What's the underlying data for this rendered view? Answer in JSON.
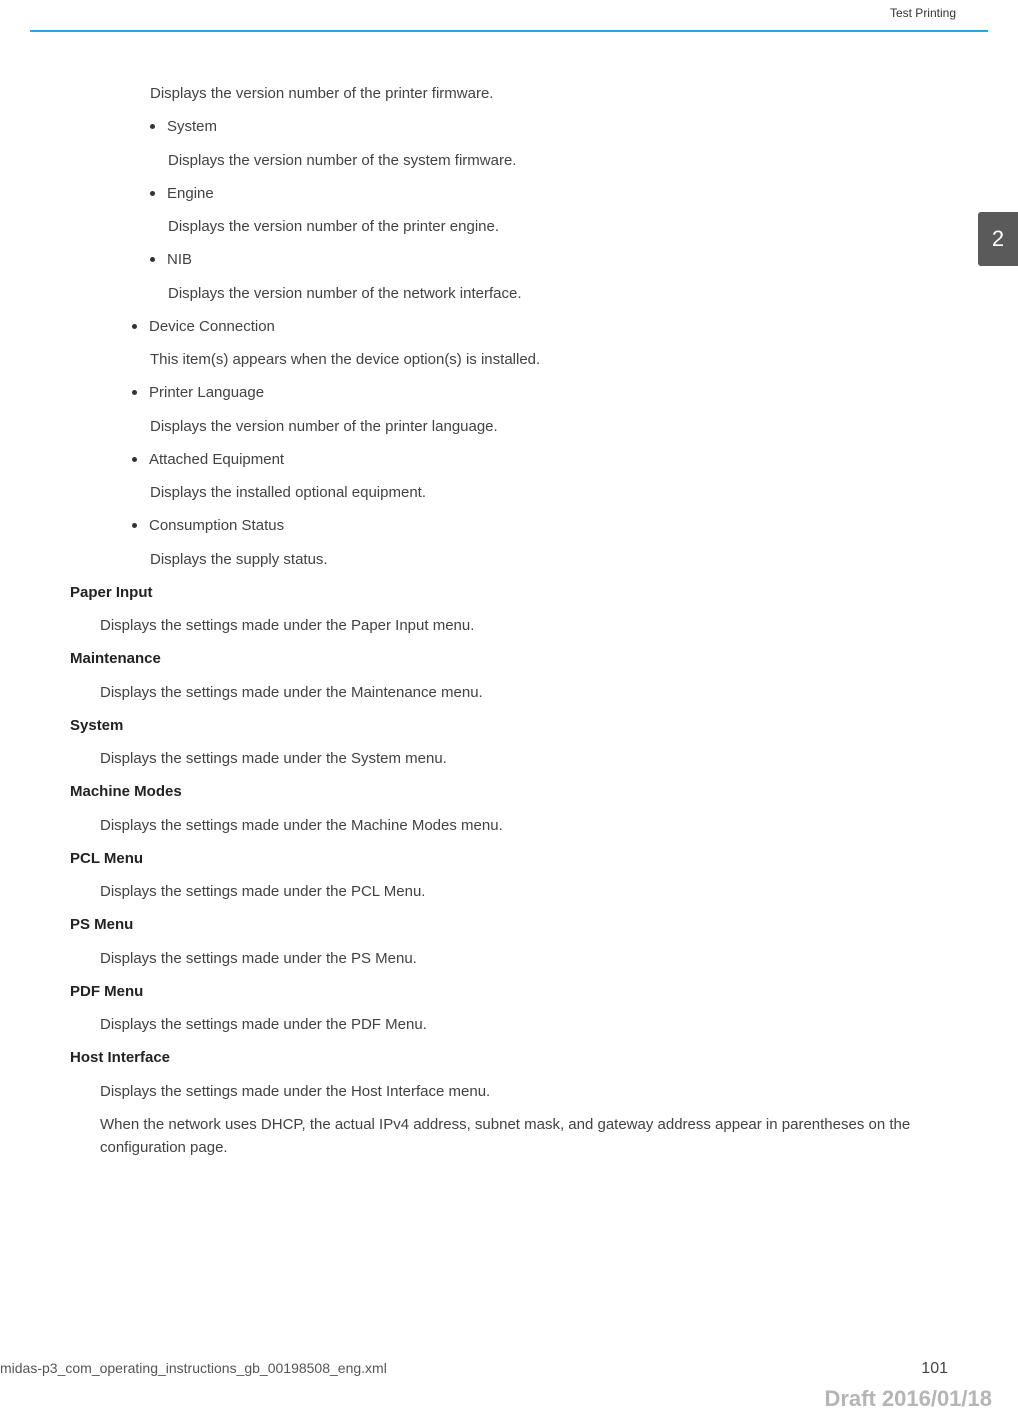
{
  "header": {
    "label": "Test Printing"
  },
  "sectionTab": "2",
  "body": {
    "p0": "Displays the version number of the printer firmware.",
    "system": {
      "title": "System",
      "desc": "Displays the version number of the system firmware."
    },
    "engine": {
      "title": "Engine",
      "desc": "Displays the version number of the printer engine."
    },
    "nib": {
      "title": "NIB",
      "desc": "Displays the version number of the network interface."
    },
    "deviceConnection": {
      "title": "Device Connection",
      "desc": "This item(s) appears when the device option(s) is installed."
    },
    "printerLanguage": {
      "title": "Printer Language",
      "desc": "Displays the version number of the printer language."
    },
    "attachedEquipment": {
      "title": "Attached Equipment",
      "desc": "Displays the installed optional equipment."
    },
    "consumptionStatus": {
      "title": "Consumption Status",
      "desc": "Displays the supply status."
    },
    "paperInput": {
      "title": "Paper Input",
      "desc": "Displays the settings made under the Paper Input menu."
    },
    "maintenance": {
      "title": "Maintenance",
      "desc": "Displays the settings made under the Maintenance menu."
    },
    "systemSection": {
      "title": "System",
      "desc": "Displays the settings made under the System menu."
    },
    "machineModes": {
      "title": "Machine Modes",
      "desc": "Displays the settings made under the Machine Modes menu."
    },
    "pclMenu": {
      "title": "PCL Menu",
      "desc": "Displays the settings made under the PCL Menu."
    },
    "psMenu": {
      "title": "PS Menu",
      "desc": "Displays the settings made under the PS Menu."
    },
    "pdfMenu": {
      "title": "PDF Menu",
      "desc": "Displays the settings made under the PDF Menu."
    },
    "hostInterface": {
      "title": "Host Interface",
      "desc1": "Displays the settings made under the Host Interface menu.",
      "desc2": "When the network uses DHCP, the actual IPv4 address, subnet mask, and gateway address appear in parentheses on the configuration page."
    }
  },
  "footer": {
    "left": "midas-p3_com_operating_instructions_gb_00198508_eng.xml",
    "right": "101"
  },
  "draft": "Draft 2016/01/18"
}
